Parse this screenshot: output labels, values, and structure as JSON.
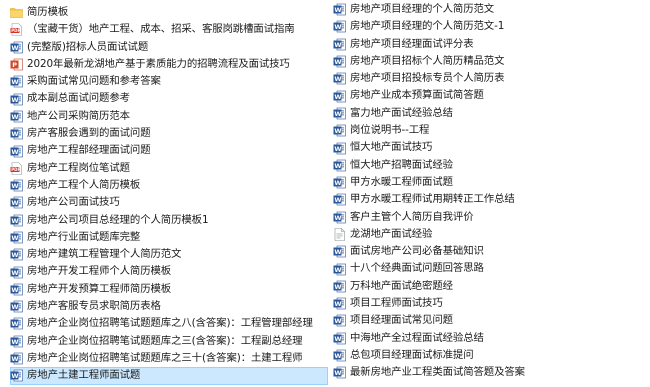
{
  "left_items": [
    {
      "name": "简历模板",
      "type": "folder"
    },
    {
      "name": "（宝藏干货）地产工程、成本、招采、客服岗跳槽面试指南",
      "type": "pdf"
    },
    {
      "name": "(完整版)招标人员面试试题",
      "type": "word"
    },
    {
      "name": "2020年最新龙湖地产基于素质能力的招聘流程及面试技巧",
      "type": "ppt"
    },
    {
      "name": "采购面试常见问题和参考答案",
      "type": "word"
    },
    {
      "name": "成本副总面试问题参考",
      "type": "word"
    },
    {
      "name": "地产公司采购简历范本",
      "type": "word"
    },
    {
      "name": "房产客服会遇到的面试问题",
      "type": "word"
    },
    {
      "name": "房地产工程部经理面试问题",
      "type": "word"
    },
    {
      "name": "房地产工程岗位笔试题",
      "type": "pdf"
    },
    {
      "name": "房地产工程个人简历模板",
      "type": "word"
    },
    {
      "name": "房地产公司面试技巧",
      "type": "word"
    },
    {
      "name": "房地产公司项目总经理的个人简历模板1",
      "type": "word"
    },
    {
      "name": "房地产行业面试题库完整",
      "type": "word"
    },
    {
      "name": "房地产建筑工程管理个人简历范文",
      "type": "word"
    },
    {
      "name": "房地产开发工程师个人简历模板",
      "type": "word"
    },
    {
      "name": "房地产开发预算工程师简历模板",
      "type": "word"
    },
    {
      "name": "房地产客服专员求职简历表格",
      "type": "word"
    },
    {
      "name": "房地产企业岗位招聘笔试题题库之八(含答案)：工程管理部经理",
      "type": "word"
    },
    {
      "name": "房地产企业岗位招聘笔试题题库之三(含答案)：工程副总经理",
      "type": "word"
    },
    {
      "name": "房地产企业岗位招聘笔试题题库之三十(含答案)：土建工程师",
      "type": "word"
    },
    {
      "name": "房地产土建工程师面试题",
      "type": "word",
      "selected": true
    }
  ],
  "right_items": [
    {
      "name": "房地产项目经理的个人简历范文",
      "type": "word"
    },
    {
      "name": "房地产项目经理的个人简历范文-1",
      "type": "word"
    },
    {
      "name": "房地产项目经理面试评分表",
      "type": "word"
    },
    {
      "name": "房地产项目招标个人简历精品范文",
      "type": "word"
    },
    {
      "name": "房地产项目招投标专员个人简历表",
      "type": "word"
    },
    {
      "name": "房地产业成本预算面试简答题",
      "type": "word"
    },
    {
      "name": "富力地产面试经验总结",
      "type": "word"
    },
    {
      "name": "岗位说明书--工程",
      "type": "word"
    },
    {
      "name": "恒大地产面试技巧",
      "type": "word"
    },
    {
      "name": "恒大地产招聘面试经验",
      "type": "word"
    },
    {
      "name": "甲方水暖工程师面试题",
      "type": "word"
    },
    {
      "name": "甲方水暖工程师试用期转正工作总结",
      "type": "word"
    },
    {
      "name": "客户主管个人简历自我评价",
      "type": "word"
    },
    {
      "name": "龙湖地产面试经验",
      "type": "doc"
    },
    {
      "name": "面试房地产公司必备基础知识",
      "type": "word"
    },
    {
      "name": "十八个经典面试问题回答思路",
      "type": "word"
    },
    {
      "name": "万科地产面试绝密题经",
      "type": "word"
    },
    {
      "name": "项目工程师面试技巧",
      "type": "word"
    },
    {
      "name": "项目经理面试常见问题",
      "type": "word"
    },
    {
      "name": "中海地产全过程面试经验总结",
      "type": "word"
    },
    {
      "name": "总包项目经理面试标准提问",
      "type": "word"
    },
    {
      "name": "最新房地产业工程类面试简答题及答案",
      "type": "word"
    }
  ],
  "colors": {
    "word_blue": "#2b579a",
    "pdf_red": "#d93025",
    "ppt_orange": "#d24726",
    "folder_yellow": "#f6c544",
    "selection_bg": "#cce8ff"
  }
}
